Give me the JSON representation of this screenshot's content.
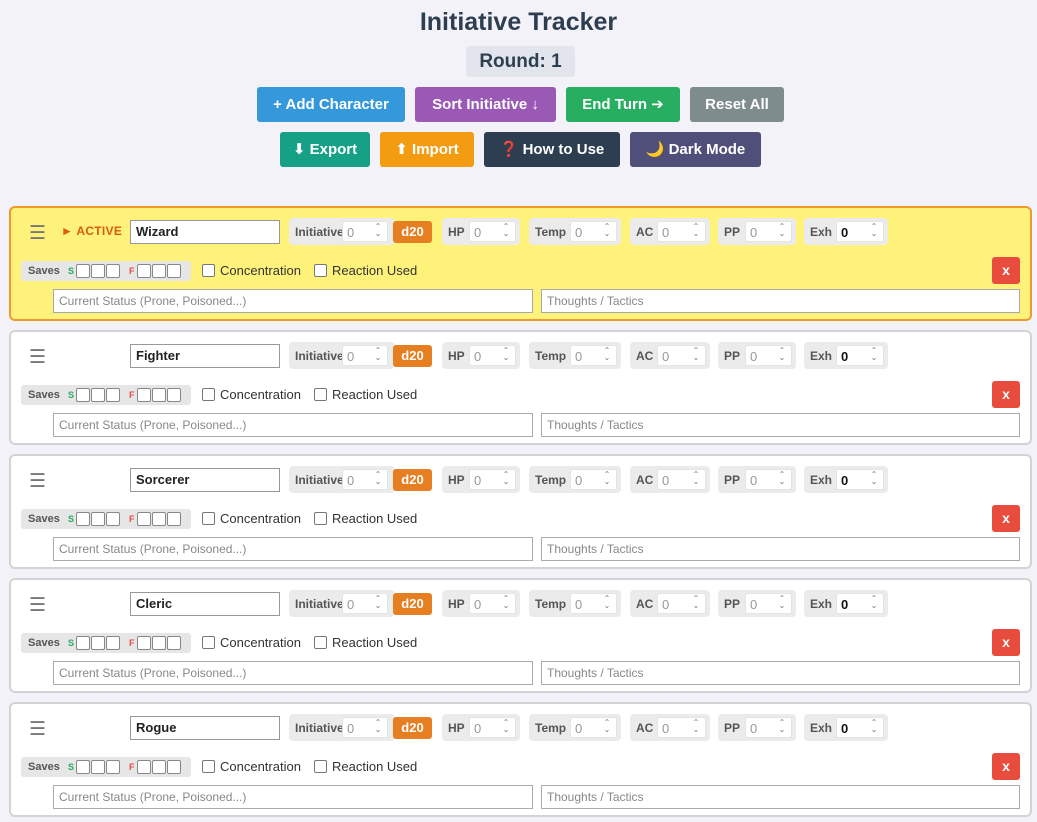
{
  "app": {
    "title": "Initiative Tracker",
    "round": "Round: 1"
  },
  "toolbar": {
    "add": "+ Add Character",
    "sort": "Sort Initiative ↓",
    "end": "End Turn ➔",
    "reset": "Reset All",
    "export": "⬇ Export",
    "import": "⬆ Import",
    "help": "❓ How to Use",
    "dark": "🌙 Dark Mode"
  },
  "colors": {
    "add": "#3498db",
    "sort": "#9b59b6",
    "end": "#27ae60",
    "reset": "#7f8c8d",
    "export": "#16a085",
    "import": "#f39c12",
    "help": "#2c3e50",
    "dark": "#4f4f7a",
    "active_bg": "#fff27a",
    "d20": "#e67e22",
    "delete": "#e74c3c"
  },
  "labels": {
    "active": "► ACTIVE",
    "initiative": "Initiative",
    "d20": "d20",
    "hp": "HP",
    "temp": "Temp",
    "ac": "AC",
    "pp": "PP",
    "exh": "Exh",
    "saves": "Saves",
    "success": "S",
    "fail": "F",
    "concentration": "Concentration",
    "reaction": "Reaction Used",
    "delete": "x",
    "status_placeholder": "Current Status (Prone, Poisoned...)",
    "thoughts_placeholder": "Thoughts / Tactics"
  },
  "characters": [
    {
      "name": "Wizard",
      "active": true,
      "initiative": "0",
      "hp": "0",
      "temp": "0",
      "ac": "0",
      "pp": "0",
      "exh": "0"
    },
    {
      "name": "Fighter",
      "active": false,
      "initiative": "0",
      "hp": "0",
      "temp": "0",
      "ac": "0",
      "pp": "0",
      "exh": "0"
    },
    {
      "name": "Sorcerer",
      "active": false,
      "initiative": "0",
      "hp": "0",
      "temp": "0",
      "ac": "0",
      "pp": "0",
      "exh": "0"
    },
    {
      "name": "Cleric",
      "active": false,
      "initiative": "0",
      "hp": "0",
      "temp": "0",
      "ac": "0",
      "pp": "0",
      "exh": "0"
    },
    {
      "name": "Rogue",
      "active": false,
      "initiative": "0",
      "hp": "0",
      "temp": "0",
      "ac": "0",
      "pp": "0",
      "exh": "0"
    }
  ]
}
